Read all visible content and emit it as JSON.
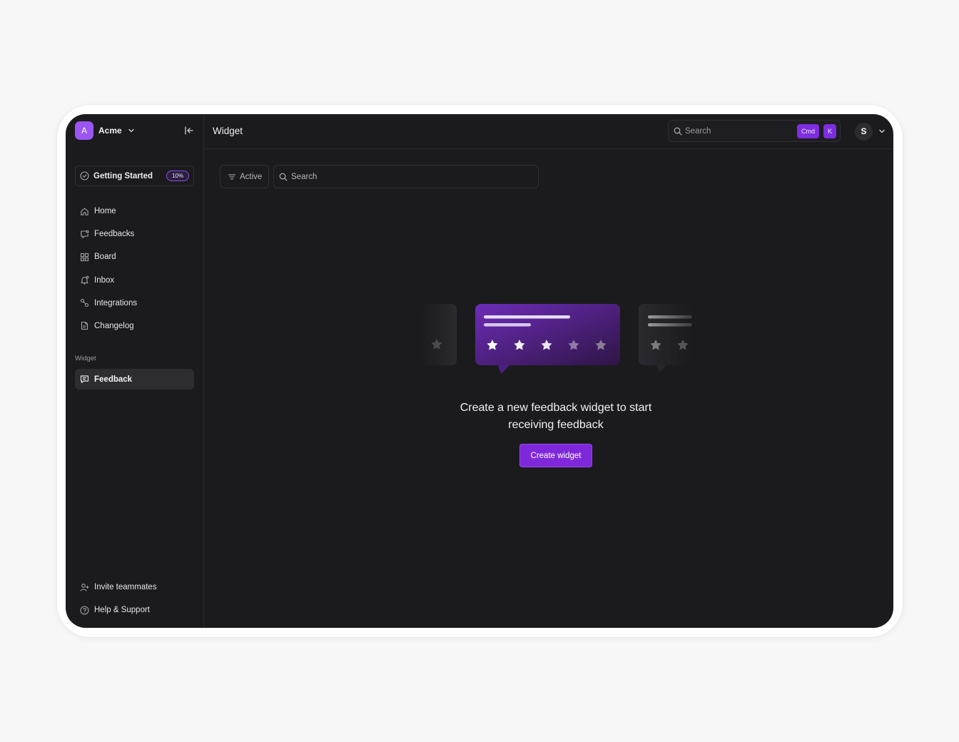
{
  "workspace": {
    "avatar_letter": "A",
    "name": "Acme"
  },
  "getting_started": {
    "label": "Getting Started",
    "progress_label": "10%",
    "progress": 0.1
  },
  "nav": [
    {
      "label": "Home",
      "icon": "home-icon"
    },
    {
      "label": "Feedbacks",
      "icon": "feedbacks-icon"
    },
    {
      "label": "Board",
      "icon": "board-icon"
    },
    {
      "label": "Inbox",
      "icon": "inbox-icon"
    },
    {
      "label": "Integrations",
      "icon": "integrations-icon"
    },
    {
      "label": "Changelog",
      "icon": "changelog-icon"
    }
  ],
  "widget_section": {
    "label": "Widget",
    "items": [
      {
        "label": "Feedback",
        "icon": "message-square-icon",
        "active": true
      }
    ]
  },
  "bottom_nav": [
    {
      "label": "Invite teammates",
      "icon": "user-plus-icon"
    },
    {
      "label": "Help & Support",
      "icon": "help-circle-icon"
    }
  ],
  "header": {
    "title": "Widget",
    "search_placeholder": "Search",
    "shortcut": [
      "Cmd",
      "K"
    ],
    "user_initial": "S"
  },
  "toolbar": {
    "filter_label": "Active",
    "search_placeholder": "Search"
  },
  "empty_state": {
    "line1": "Create a new feedback widget to start",
    "line2": "receiving feedback",
    "button_label": "Create widget",
    "rating_stars": 5
  },
  "colors": {
    "accent": "#7f28db",
    "accent_light": "#9a55f2",
    "app_bg": "#1b1b1e",
    "border": "#2a2a2e"
  }
}
